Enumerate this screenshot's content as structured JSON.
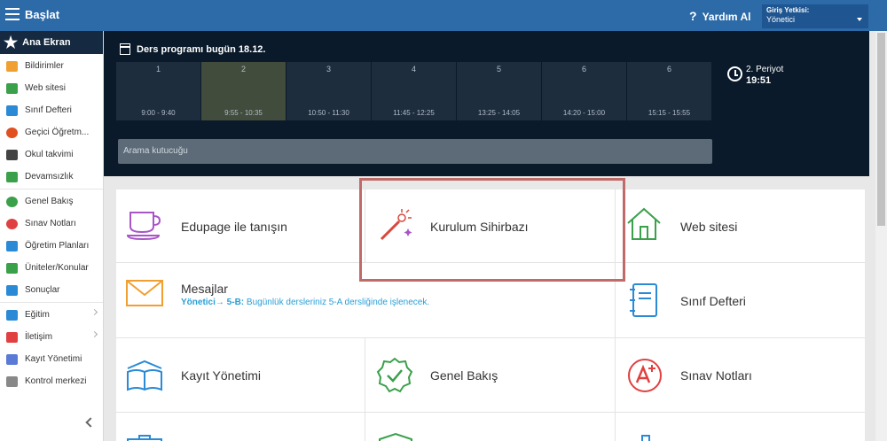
{
  "topbar": {
    "title": "Başlat",
    "help_label": "Yardım Al",
    "login_label": "Giriş Yetkisi:",
    "login_value": "Yönetici"
  },
  "sidebar": {
    "home_label": "Ana Ekran",
    "group1": [
      {
        "label": "Bildirimler",
        "icon": "envelope-icon",
        "color": "#f0a030"
      },
      {
        "label": "Web sitesi",
        "icon": "house-icon",
        "color": "#3aa04a"
      },
      {
        "label": "Sınıf Defteri",
        "icon": "notebook-icon",
        "color": "#2a8ad6"
      },
      {
        "label": "Geçici Öğretm...",
        "icon": "person-icon",
        "color": "#e05020"
      },
      {
        "label": "Okul takvimi",
        "icon": "calendar-icon",
        "color": "#444444"
      },
      {
        "label": "Devamsızlık",
        "icon": "attendance-icon",
        "color": "#3aa04a"
      }
    ],
    "group2": [
      {
        "label": "Genel Bakış",
        "icon": "check-circle-icon",
        "color": "#3aa04a"
      },
      {
        "label": "Sınav Notları",
        "icon": "grade-icon",
        "color": "#e04040"
      },
      {
        "label": "Öğretim Planları",
        "icon": "plan-icon",
        "color": "#2a8ad6"
      },
      {
        "label": "Üniteler/Konular",
        "icon": "shield-icon",
        "color": "#3aa04a"
      },
      {
        "label": "Sonuçlar",
        "icon": "bar-chart-icon",
        "color": "#2a8ad6"
      }
    ],
    "group3": [
      {
        "label": "Eğitim",
        "icon": "education-icon",
        "color": "#2a8ad6",
        "chevron": true
      },
      {
        "label": "İletişim",
        "icon": "chat-icon",
        "color": "#e04040",
        "chevron": true
      },
      {
        "label": "Kayıt Yönetimi",
        "icon": "pen-icon",
        "color": "#5a7ad6",
        "chevron": false
      },
      {
        "label": "Kontrol merkezi",
        "icon": "gear-icon",
        "color": "#888888",
        "chevron": false
      }
    ]
  },
  "schedule": {
    "heading": "Ders programı bugün 18.12.",
    "periods": [
      {
        "num": "1",
        "time": "9:00 - 9:40"
      },
      {
        "num": "2",
        "time": "9:55 - 10:35"
      },
      {
        "num": "3",
        "time": "10:50 - 11:30"
      },
      {
        "num": "4",
        "time": "11:45 - 12:25"
      },
      {
        "num": "5",
        "time": "13:25 - 14:05"
      },
      {
        "num": "6",
        "time": "14:20 - 15:00"
      },
      {
        "num": "6",
        "time": "15:15 - 15:55"
      }
    ],
    "active_index": 1,
    "current_period": "2. Periyot",
    "current_time": "19:51",
    "search_placeholder": "Arama kutucuğu"
  },
  "tiles": {
    "t1": "Edupage ile tanışın",
    "t2": "Kurulum Sihirbazı",
    "t3": "Web sitesi",
    "t4": "Mesajlar",
    "t4_sub_bold": "Yönetici→ 5-B:",
    "t4_sub": " Bugünlük dersleriniz 5-A dersliğinde işlenecek.",
    "t5": "Sınıf Defteri",
    "t6": "Kayıt Yönetimi",
    "t7": "Genel Bakış",
    "t8": "Sınav Notları"
  },
  "colors": {
    "topbar": "#2c6aa8",
    "dark_panel": "#0a1a2a",
    "highlight": "#c06a6a"
  }
}
